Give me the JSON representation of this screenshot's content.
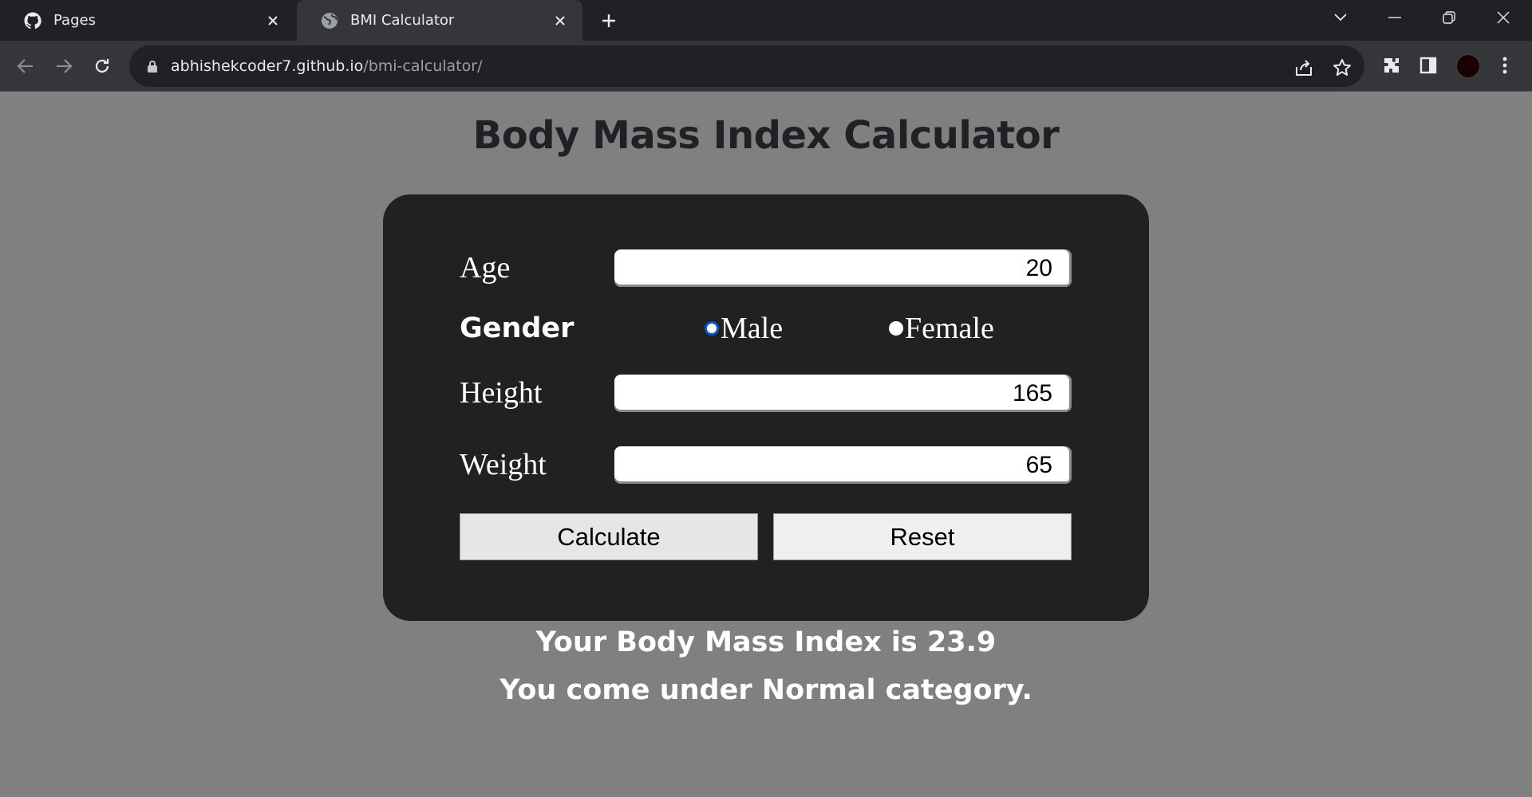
{
  "browser": {
    "tabs": [
      {
        "title": "Pages",
        "icon": "github-icon",
        "active": false
      },
      {
        "title": "BMI Calculator",
        "icon": "globe-icon",
        "active": true
      }
    ],
    "url_host": "abhishekcoder7.github.io",
    "url_path": "/bmi-calculator/"
  },
  "page": {
    "title": "Body Mass Index Calculator"
  },
  "form": {
    "age_label": "Age",
    "age_value": "20",
    "gender_label": "Gender",
    "gender_options": [
      "Male",
      "Female"
    ],
    "gender_selected": "Male",
    "height_label": "Height",
    "height_value": "165",
    "weight_label": "Weight",
    "weight_value": "65",
    "calculate_label": "Calculate",
    "reset_label": "Reset"
  },
  "result": {
    "bmi_text": "Your Body Mass Index is 23.9",
    "category_text": "You come under Normal category."
  },
  "colors": {
    "page_bg": "#808080",
    "card_bg": "#212121",
    "chrome_dark": "#202124",
    "chrome_toolbar": "#35363a",
    "radio_accent": "#0b57d0"
  }
}
